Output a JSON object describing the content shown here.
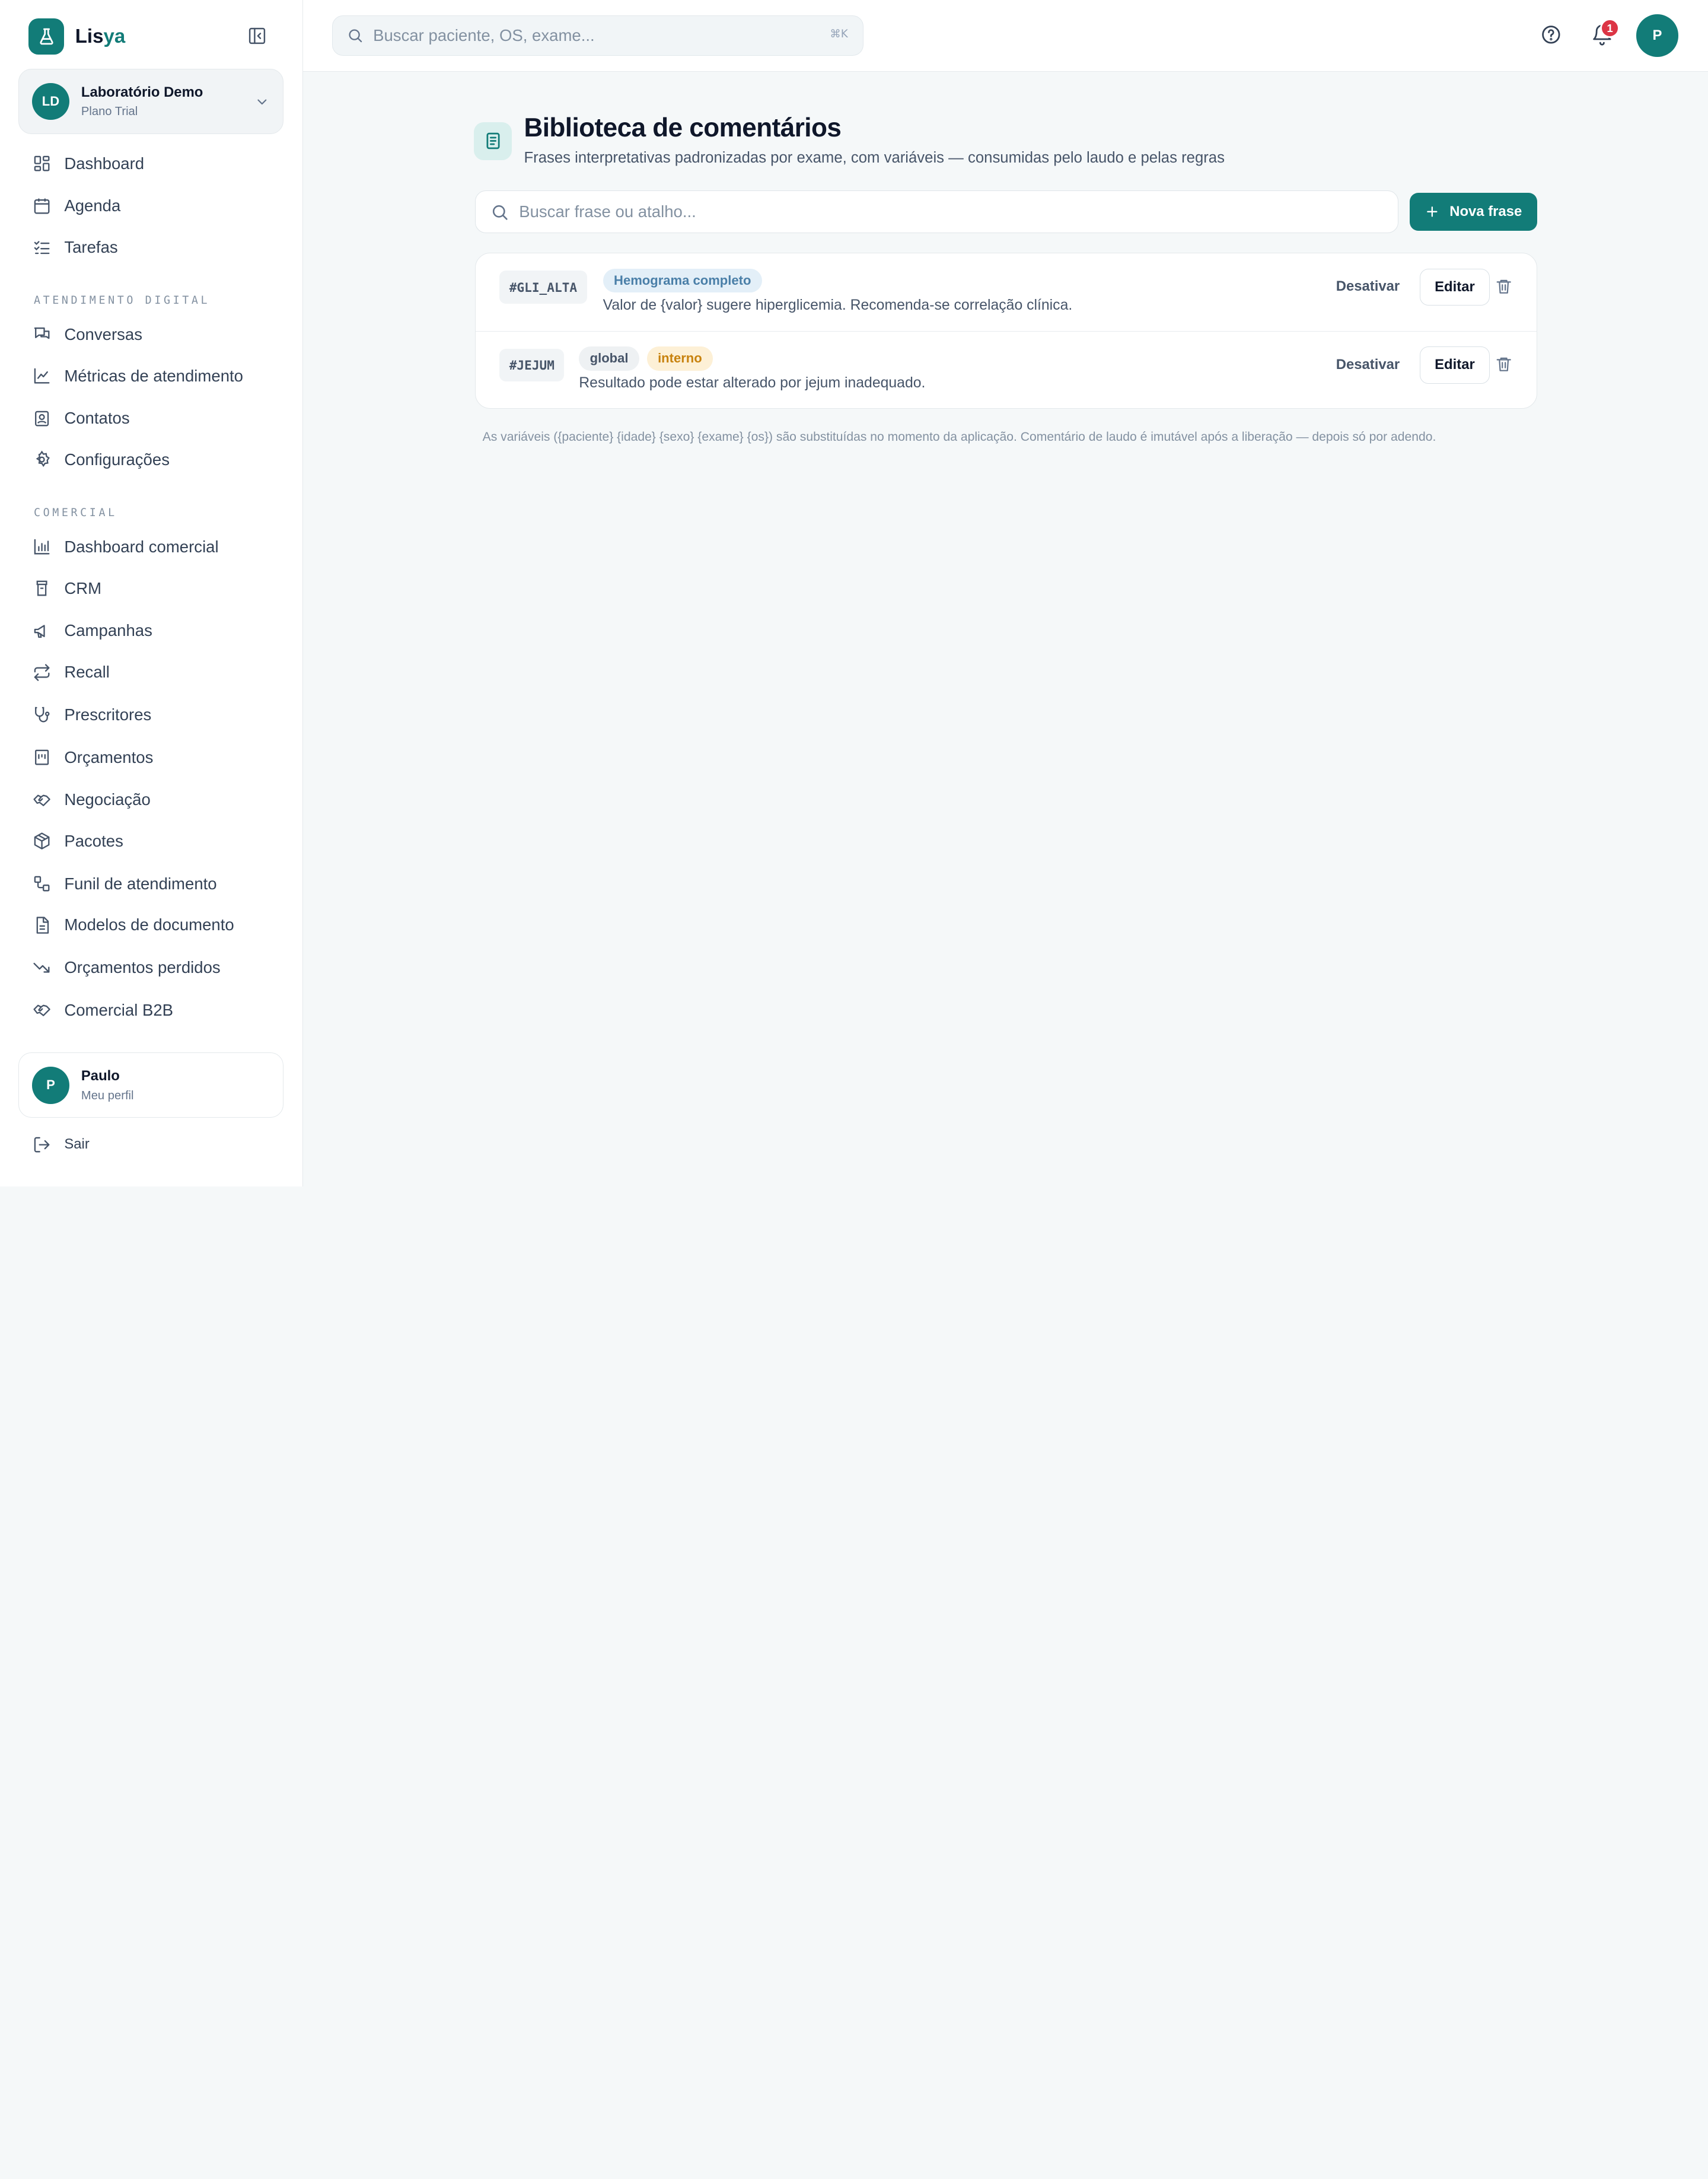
{
  "brand": {
    "name_main": "Lis",
    "name_accent": "ya",
    "color": "#127c78"
  },
  "org": {
    "initials": "LD",
    "name": "Laboratório Demo",
    "plan": "Plano Trial"
  },
  "nav": {
    "main": [
      {
        "label": "Dashboard",
        "icon": "dashboard-icon"
      },
      {
        "label": "Agenda",
        "icon": "calendar-icon"
      },
      {
        "label": "Tarefas",
        "icon": "checklist-icon"
      }
    ],
    "digital_title": "ATENDIMENTO DIGITAL",
    "digital": [
      {
        "label": "Conversas",
        "icon": "chat-icon"
      },
      {
        "label": "Métricas de atendimento",
        "icon": "line-chart-icon"
      },
      {
        "label": "Contatos",
        "icon": "contact-icon"
      },
      {
        "label": "Configurações",
        "icon": "gear-icon"
      }
    ],
    "commercial_title": "COMERCIAL",
    "commercial": [
      {
        "label": "Dashboard comercial",
        "icon": "bar-chart-icon"
      },
      {
        "label": "CRM",
        "icon": "crm-icon"
      },
      {
        "label": "Campanhas",
        "icon": "megaphone-icon"
      },
      {
        "label": "Recall",
        "icon": "repeat-icon"
      },
      {
        "label": "Prescritores",
        "icon": "stethoscope-icon"
      },
      {
        "label": "Orçamentos",
        "icon": "receipt-icon"
      },
      {
        "label": "Negociação",
        "icon": "handshake-icon"
      },
      {
        "label": "Pacotes",
        "icon": "package-icon"
      },
      {
        "label": "Funil de atendimento",
        "icon": "workflow-icon"
      },
      {
        "label": "Modelos de documento",
        "icon": "document-icon"
      },
      {
        "label": "Orçamentos perdidos",
        "icon": "trending-down-icon"
      },
      {
        "label": "Comercial B2B",
        "icon": "handshake-icon"
      }
    ]
  },
  "profile": {
    "initial": "P",
    "name": "Paulo",
    "subtitle": "Meu perfil"
  },
  "logout_label": "Sair",
  "topbar": {
    "search_placeholder": "Buscar paciente, OS, exame...",
    "shortcut": "⌘K",
    "notification_count": "1",
    "avatar_initial": "P"
  },
  "page": {
    "title": "Biblioteca de comentários",
    "subtitle": "Frases interpretativas padronizadas por exame, com variáveis — consumidas pelo laudo e pelas regras",
    "search_placeholder": "Buscar frase ou atalho...",
    "new_button": "Nova frase"
  },
  "phrases": [
    {
      "shortcut": "#GLI_ALTA",
      "tags": [
        {
          "label": "Hemograma completo",
          "style": "blue"
        }
      ],
      "text": "Valor de {valor} sugere hiperglicemia. Recomenda-se correlação clínica.",
      "deactivate": "Desativar",
      "edit": "Editar"
    },
    {
      "shortcut": "#JEJUM",
      "tags": [
        {
          "label": "global",
          "style": "gray"
        },
        {
          "label": "interno",
          "style": "amber"
        }
      ],
      "text": "Resultado pode estar alterado por jejum inadequado.",
      "deactivate": "Desativar",
      "edit": "Editar"
    }
  ],
  "footnote": "As variáveis ({paciente} {idade} {sexo} {exame} {os}) são substituídas no momento da aplicação. Comentário de laudo é imutável após a liberação — depois só por adendo."
}
